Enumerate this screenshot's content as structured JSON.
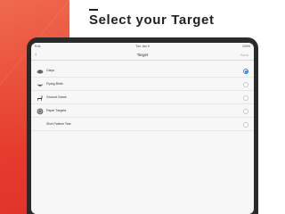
{
  "headline": "Select your Target",
  "status": {
    "time": "9:41",
    "date": "Tue Jan 9",
    "battery": "100%"
  },
  "nav": {
    "title": "Target",
    "save_label": "Save"
  },
  "targets": [
    {
      "label": "Clays",
      "icon": "clay-target-icon",
      "selected": true
    },
    {
      "label": "Flying Birds",
      "icon": "flying-bird-icon",
      "selected": false
    },
    {
      "label": "Ground Game",
      "icon": "deer-icon",
      "selected": false
    },
    {
      "label": "Paper Targets",
      "icon": "paper-target-icon",
      "selected": false
    },
    {
      "label": "Shot Pattern Test",
      "icon": "",
      "selected": false
    }
  ],
  "colors": {
    "accent": "#2f7df6",
    "brand_red": "#e53a2d"
  }
}
